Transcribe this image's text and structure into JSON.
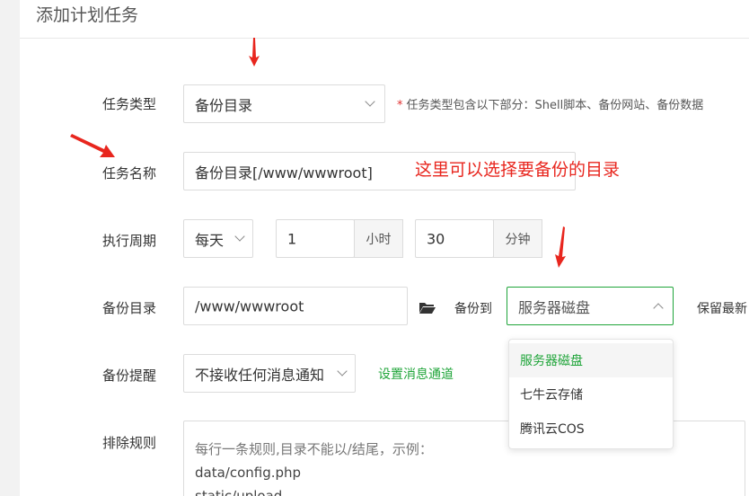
{
  "header": {
    "title": "添加计划任务"
  },
  "task_type": {
    "label": "任务类型",
    "value": "备份目录",
    "hint_star": "*",
    "hint": "任务类型包含以下部分：Shell脚本、备份网站、备份数据"
  },
  "task_name": {
    "label": "任务名称",
    "value": "备份目录[/www/wwwroot]",
    "annotation": "这里可以选择要备份的目录"
  },
  "schedule": {
    "label": "执行周期",
    "period": "每天",
    "hour_value": "1",
    "hour_unit": "小时",
    "minute_value": "30",
    "minute_unit": "分钟"
  },
  "backup_dir": {
    "label": "备份目录",
    "path": "/www/wwwroot",
    "backup_to_label": "备份到",
    "backup_to_value": "服务器磁盘",
    "keep_latest": "保留最新"
  },
  "dropdown": {
    "options": [
      "服务器磁盘",
      "七牛云存储",
      "腾讯云COS"
    ],
    "selected_index": 0
  },
  "reminder": {
    "label": "备份提醒",
    "value": "不接收任何消息通知",
    "link": "设置消息通道"
  },
  "exclude": {
    "label": "排除规则",
    "placeholder_line1": "每行一条规则,目录不能以/结尾，示例：",
    "placeholder_line2": "data/config.php",
    "placeholder_line3": "static/upload"
  },
  "colors": {
    "accent": "#20a53a",
    "annotation": "#e8261e"
  },
  "icons": {
    "folder": "folder-open-icon",
    "chevron": "chevron-down-icon"
  }
}
